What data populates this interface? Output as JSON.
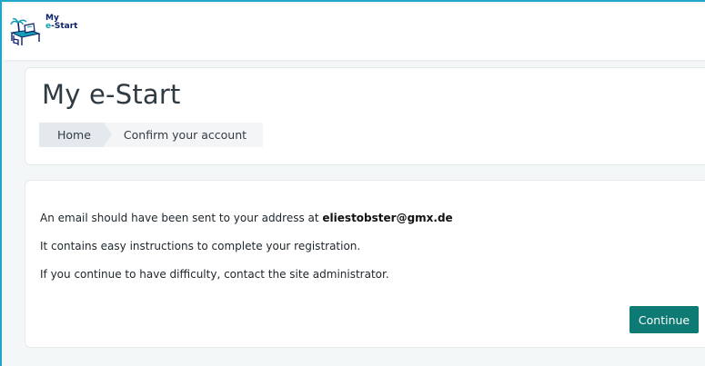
{
  "brand": {
    "logo_line1": "My",
    "logo_line2_prefix": "e",
    "logo_line2_suffix": "-Start"
  },
  "header": {
    "title": "My e-Start"
  },
  "breadcrumb": [
    {
      "label": "Home"
    },
    {
      "label": "Confirm your account"
    }
  ],
  "message": {
    "line1_prefix": "An email should have been sent to your address at ",
    "email": "eliestobster@gmx.de",
    "line2": "It contains easy instructions to complete your registration.",
    "line3": "If you continue to have difficulty, contact the site administrator."
  },
  "actions": {
    "continue_label": "Continue"
  },
  "colors": {
    "accent": "#0d7a73",
    "frame": "#1fa6c8",
    "brand_navy": "#0b1f6a",
    "brand_teal": "#14a0b4"
  }
}
